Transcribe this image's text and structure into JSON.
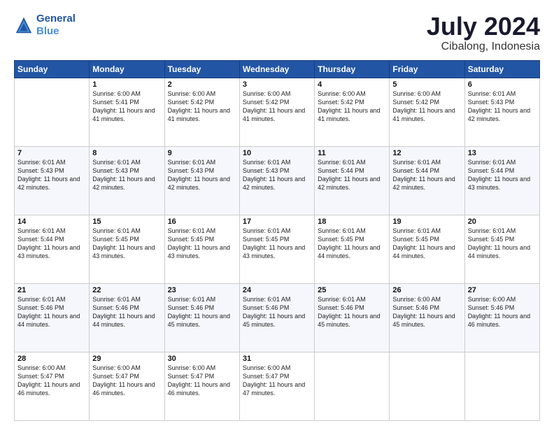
{
  "logo": {
    "line1": "General",
    "line2": "Blue"
  },
  "title": "July 2024",
  "subtitle": "Cibalong, Indonesia",
  "days_header": [
    "Sunday",
    "Monday",
    "Tuesday",
    "Wednesday",
    "Thursday",
    "Friday",
    "Saturday"
  ],
  "weeks": [
    [
      {
        "day": "",
        "sunrise": "",
        "sunset": "",
        "daylight": ""
      },
      {
        "day": "1",
        "sunrise": "Sunrise: 6:00 AM",
        "sunset": "Sunset: 5:41 PM",
        "daylight": "Daylight: 11 hours and 41 minutes."
      },
      {
        "day": "2",
        "sunrise": "Sunrise: 6:00 AM",
        "sunset": "Sunset: 5:42 PM",
        "daylight": "Daylight: 11 hours and 41 minutes."
      },
      {
        "day": "3",
        "sunrise": "Sunrise: 6:00 AM",
        "sunset": "Sunset: 5:42 PM",
        "daylight": "Daylight: 11 hours and 41 minutes."
      },
      {
        "day": "4",
        "sunrise": "Sunrise: 6:00 AM",
        "sunset": "Sunset: 5:42 PM",
        "daylight": "Daylight: 11 hours and 41 minutes."
      },
      {
        "day": "5",
        "sunrise": "Sunrise: 6:00 AM",
        "sunset": "Sunset: 5:42 PM",
        "daylight": "Daylight: 11 hours and 41 minutes."
      },
      {
        "day": "6",
        "sunrise": "Sunrise: 6:01 AM",
        "sunset": "Sunset: 5:43 PM",
        "daylight": "Daylight: 11 hours and 42 minutes."
      }
    ],
    [
      {
        "day": "7",
        "sunrise": "Sunrise: 6:01 AM",
        "sunset": "Sunset: 5:43 PM",
        "daylight": "Daylight: 11 hours and 42 minutes."
      },
      {
        "day": "8",
        "sunrise": "Sunrise: 6:01 AM",
        "sunset": "Sunset: 5:43 PM",
        "daylight": "Daylight: 11 hours and 42 minutes."
      },
      {
        "day": "9",
        "sunrise": "Sunrise: 6:01 AM",
        "sunset": "Sunset: 5:43 PM",
        "daylight": "Daylight: 11 hours and 42 minutes."
      },
      {
        "day": "10",
        "sunrise": "Sunrise: 6:01 AM",
        "sunset": "Sunset: 5:43 PM",
        "daylight": "Daylight: 11 hours and 42 minutes."
      },
      {
        "day": "11",
        "sunrise": "Sunrise: 6:01 AM",
        "sunset": "Sunset: 5:44 PM",
        "daylight": "Daylight: 11 hours and 42 minutes."
      },
      {
        "day": "12",
        "sunrise": "Sunrise: 6:01 AM",
        "sunset": "Sunset: 5:44 PM",
        "daylight": "Daylight: 11 hours and 42 minutes."
      },
      {
        "day": "13",
        "sunrise": "Sunrise: 6:01 AM",
        "sunset": "Sunset: 5:44 PM",
        "daylight": "Daylight: 11 hours and 43 minutes."
      }
    ],
    [
      {
        "day": "14",
        "sunrise": "Sunrise: 6:01 AM",
        "sunset": "Sunset: 5:44 PM",
        "daylight": "Daylight: 11 hours and 43 minutes."
      },
      {
        "day": "15",
        "sunrise": "Sunrise: 6:01 AM",
        "sunset": "Sunset: 5:45 PM",
        "daylight": "Daylight: 11 hours and 43 minutes."
      },
      {
        "day": "16",
        "sunrise": "Sunrise: 6:01 AM",
        "sunset": "Sunset: 5:45 PM",
        "daylight": "Daylight: 11 hours and 43 minutes."
      },
      {
        "day": "17",
        "sunrise": "Sunrise: 6:01 AM",
        "sunset": "Sunset: 5:45 PM",
        "daylight": "Daylight: 11 hours and 43 minutes."
      },
      {
        "day": "18",
        "sunrise": "Sunrise: 6:01 AM",
        "sunset": "Sunset: 5:45 PM",
        "daylight": "Daylight: 11 hours and 44 minutes."
      },
      {
        "day": "19",
        "sunrise": "Sunrise: 6:01 AM",
        "sunset": "Sunset: 5:45 PM",
        "daylight": "Daylight: 11 hours and 44 minutes."
      },
      {
        "day": "20",
        "sunrise": "Sunrise: 6:01 AM",
        "sunset": "Sunset: 5:45 PM",
        "daylight": "Daylight: 11 hours and 44 minutes."
      }
    ],
    [
      {
        "day": "21",
        "sunrise": "Sunrise: 6:01 AM",
        "sunset": "Sunset: 5:46 PM",
        "daylight": "Daylight: 11 hours and 44 minutes."
      },
      {
        "day": "22",
        "sunrise": "Sunrise: 6:01 AM",
        "sunset": "Sunset: 5:46 PM",
        "daylight": "Daylight: 11 hours and 44 minutes."
      },
      {
        "day": "23",
        "sunrise": "Sunrise: 6:01 AM",
        "sunset": "Sunset: 5:46 PM",
        "daylight": "Daylight: 11 hours and 45 minutes."
      },
      {
        "day": "24",
        "sunrise": "Sunrise: 6:01 AM",
        "sunset": "Sunset: 5:46 PM",
        "daylight": "Daylight: 11 hours and 45 minutes."
      },
      {
        "day": "25",
        "sunrise": "Sunrise: 6:01 AM",
        "sunset": "Sunset: 5:46 PM",
        "daylight": "Daylight: 11 hours and 45 minutes."
      },
      {
        "day": "26",
        "sunrise": "Sunrise: 6:00 AM",
        "sunset": "Sunset: 5:46 PM",
        "daylight": "Daylight: 11 hours and 45 minutes."
      },
      {
        "day": "27",
        "sunrise": "Sunrise: 6:00 AM",
        "sunset": "Sunset: 5:46 PM",
        "daylight": "Daylight: 11 hours and 46 minutes."
      }
    ],
    [
      {
        "day": "28",
        "sunrise": "Sunrise: 6:00 AM",
        "sunset": "Sunset: 5:47 PM",
        "daylight": "Daylight: 11 hours and 46 minutes."
      },
      {
        "day": "29",
        "sunrise": "Sunrise: 6:00 AM",
        "sunset": "Sunset: 5:47 PM",
        "daylight": "Daylight: 11 hours and 46 minutes."
      },
      {
        "day": "30",
        "sunrise": "Sunrise: 6:00 AM",
        "sunset": "Sunset: 5:47 PM",
        "daylight": "Daylight: 11 hours and 46 minutes."
      },
      {
        "day": "31",
        "sunrise": "Sunrise: 6:00 AM",
        "sunset": "Sunset: 5:47 PM",
        "daylight": "Daylight: 11 hours and 47 minutes."
      },
      {
        "day": "",
        "sunrise": "",
        "sunset": "",
        "daylight": ""
      },
      {
        "day": "",
        "sunrise": "",
        "sunset": "",
        "daylight": ""
      },
      {
        "day": "",
        "sunrise": "",
        "sunset": "",
        "daylight": ""
      }
    ]
  ]
}
